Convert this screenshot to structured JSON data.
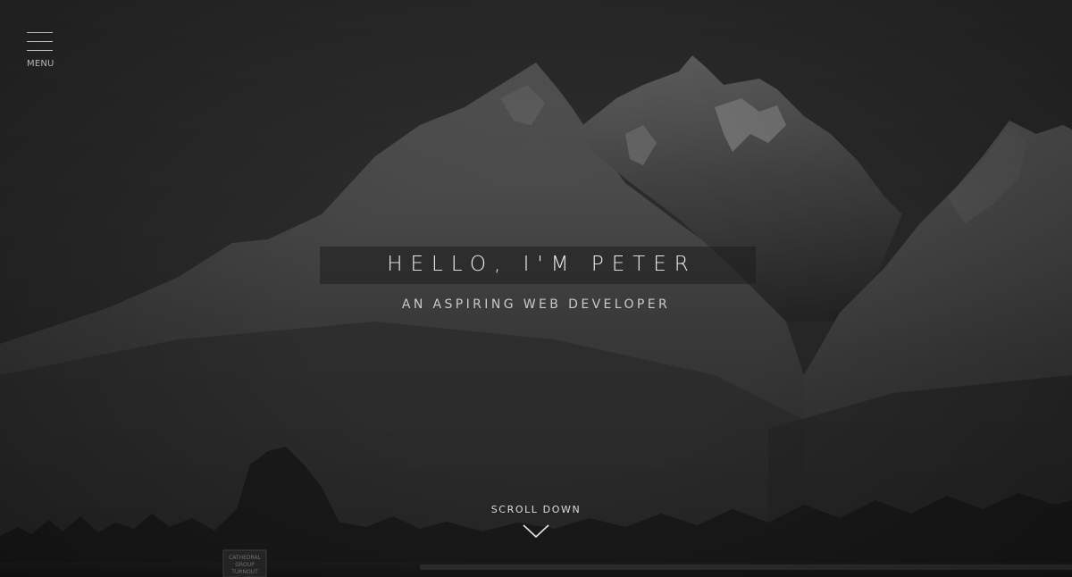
{
  "menu": {
    "label": "MENU",
    "icon": "hamburger-icon"
  },
  "hero": {
    "title": "HELLO, I'M PETER",
    "subtitle": "AN ASPIRING WEB DEVELOPER"
  },
  "scroll": {
    "label": "SCROLL DOWN",
    "icon": "chevron-down-icon"
  },
  "sign": {
    "lines": [
      "CATHEDRAL",
      "GROUP",
      "TURNOUT"
    ]
  },
  "colors": {
    "text": "#ececec",
    "background": "#2c2c2c"
  }
}
